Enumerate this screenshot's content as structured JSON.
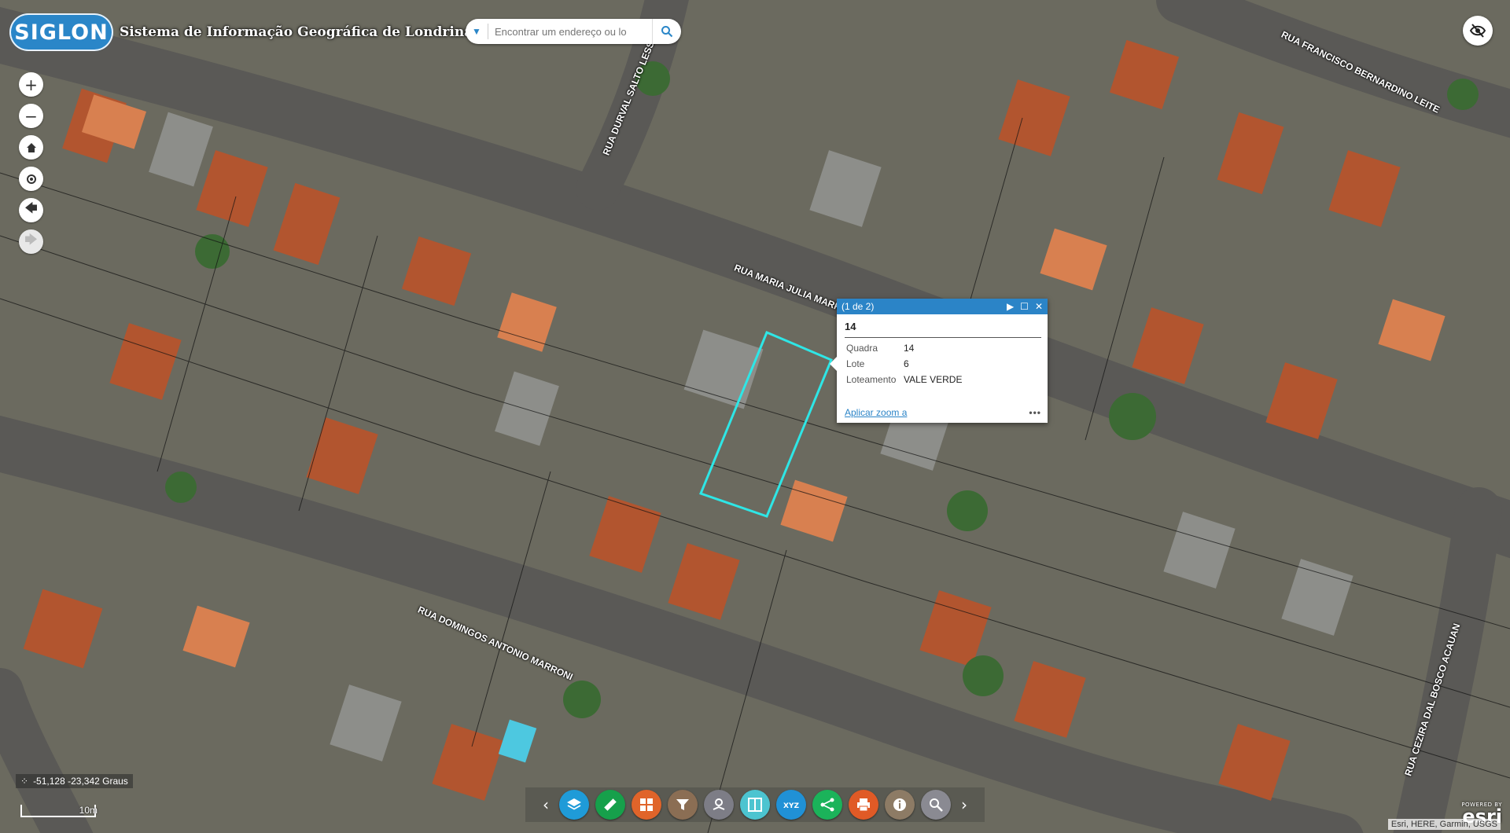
{
  "header": {
    "logo": "SIGLON",
    "title": "Sistema de Informação Geográfica de Londrina"
  },
  "search": {
    "placeholder": "Encontrar um endereço ou lo"
  },
  "streets": [
    "RUA FRANCISCO BERNARDINO LEITE",
    "RUA DURVAL SALTO LESSI",
    "RUA MARIA JULIA MARRO",
    "RUA DOMINGOS ANTONIO MARRONI",
    "RUA CEZIRA DAL BOSCO ACAUAN"
  ],
  "popup": {
    "counter": "(1 de 2)",
    "title": "14",
    "rows": [
      {
        "key": "Quadra",
        "value": "14"
      },
      {
        "key": "Lote",
        "value": "6"
      },
      {
        "key": "Loteamento",
        "value": "VALE VERDE"
      }
    ],
    "zoom_link": "Aplicar zoom a",
    "more": "•••"
  },
  "coords": "-51,128 -23,342 Graus",
  "scale": "10m",
  "attribution": "Esri, HERE, Garmin, USGS",
  "esri": {
    "powered": "POWERED BY",
    "name": "esri"
  },
  "colors": {
    "accent": "#2b84c7",
    "selection": "#2ee6e6",
    "widgets": [
      "#1f9bd8",
      "#16a04b",
      "#e0642a",
      "#8b6e54",
      "#7d7d86",
      "#4cc4d0",
      "#2091d6",
      "#1bb35a",
      "#e05a26",
      "#8d7b65",
      "#8a8a92"
    ]
  }
}
